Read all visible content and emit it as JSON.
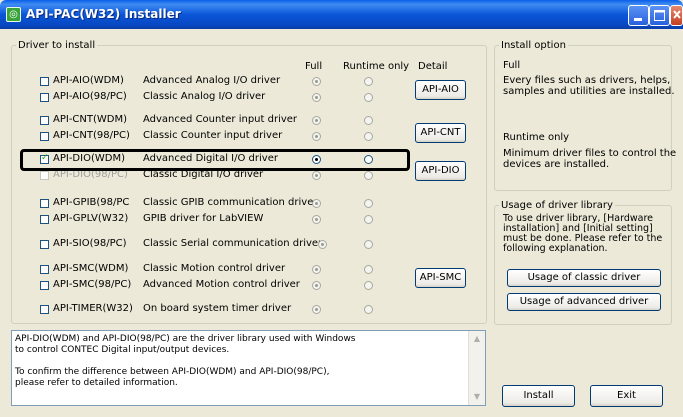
{
  "window": {
    "title": "API-PAC(W32) Installer",
    "icon_glyph": "◎"
  },
  "driver_group": {
    "legend": "Driver to install",
    "headers": {
      "full": "Full",
      "runtime": "Runtime only",
      "detail": "Detail"
    },
    "rows": [
      {
        "name": "API-AIO(WDM)",
        "desc": "Advanced Analog I/O driver"
      },
      {
        "name": "API-AIO(98/PC)",
        "desc": "Classic Analog I/O driver"
      },
      {
        "name": "API-CNT(WDM)",
        "desc": "Advanced Counter input driver"
      },
      {
        "name": "API-CNT(98/PC)",
        "desc": "Classic Counter input driver"
      },
      {
        "name": "API-DIO(WDM)",
        "desc": "Advanced Digital I/O driver",
        "checked": true
      },
      {
        "name": "API-DIO(98/PC)",
        "desc": "Classic Digital I/O driver",
        "disabled": true
      },
      {
        "name": "API-GPIB(98/PC",
        "desc": "Classic GPIB communication driver"
      },
      {
        "name": "API-GPLV(W32)",
        "desc": "GPIB driver for LabVIEW"
      },
      {
        "name": "API-SIO(98/PC)",
        "desc": "Classic Serial communication driver"
      },
      {
        "name": "API-SMC(WDM)",
        "desc": "Classic Motion control driver"
      },
      {
        "name": "API-SMC(98/PC)",
        "desc": "Advanced Motion control driver"
      },
      {
        "name": "API-TIMER(W32)",
        "desc": "On board system timer driver"
      }
    ],
    "detail_buttons": {
      "aio": "API-AIO",
      "cnt": "API-CNT",
      "dio": "API-DIO",
      "smc": "API-SMC"
    }
  },
  "install_option": {
    "legend": "Install option",
    "full_title": "Full",
    "full_desc": "Every files such as drivers, helps,\nsamples and utilities are installed.",
    "runtime_title": "Runtime only",
    "runtime_desc": "Minimum driver files to control the\ndevices are installed."
  },
  "usage_group": {
    "legend": "Usage of driver library",
    "desc": "To use driver library, [Hardware\ninstallation] and [Initial setting]\nmust be done. Please refer to the\nfollowing explanation.",
    "classic_button": "Usage of classic driver",
    "advanced_button": "Usage of advanced driver"
  },
  "info_box": {
    "text": "API-DIO(WDM) and API-DIO(98/PC) are the driver library used with Windows\nto control CONTEC Digital input/output devices.\n\nTo confirm the difference between API-DIO(WDM) and API-DIO(98/PC),\nplease refer to detailed information."
  },
  "footer": {
    "install": "Install",
    "exit": "Exit"
  },
  "colors": {
    "title_bar": "#0848c4",
    "highlight_border": "#000000",
    "window_bg": "#ece9d8"
  }
}
